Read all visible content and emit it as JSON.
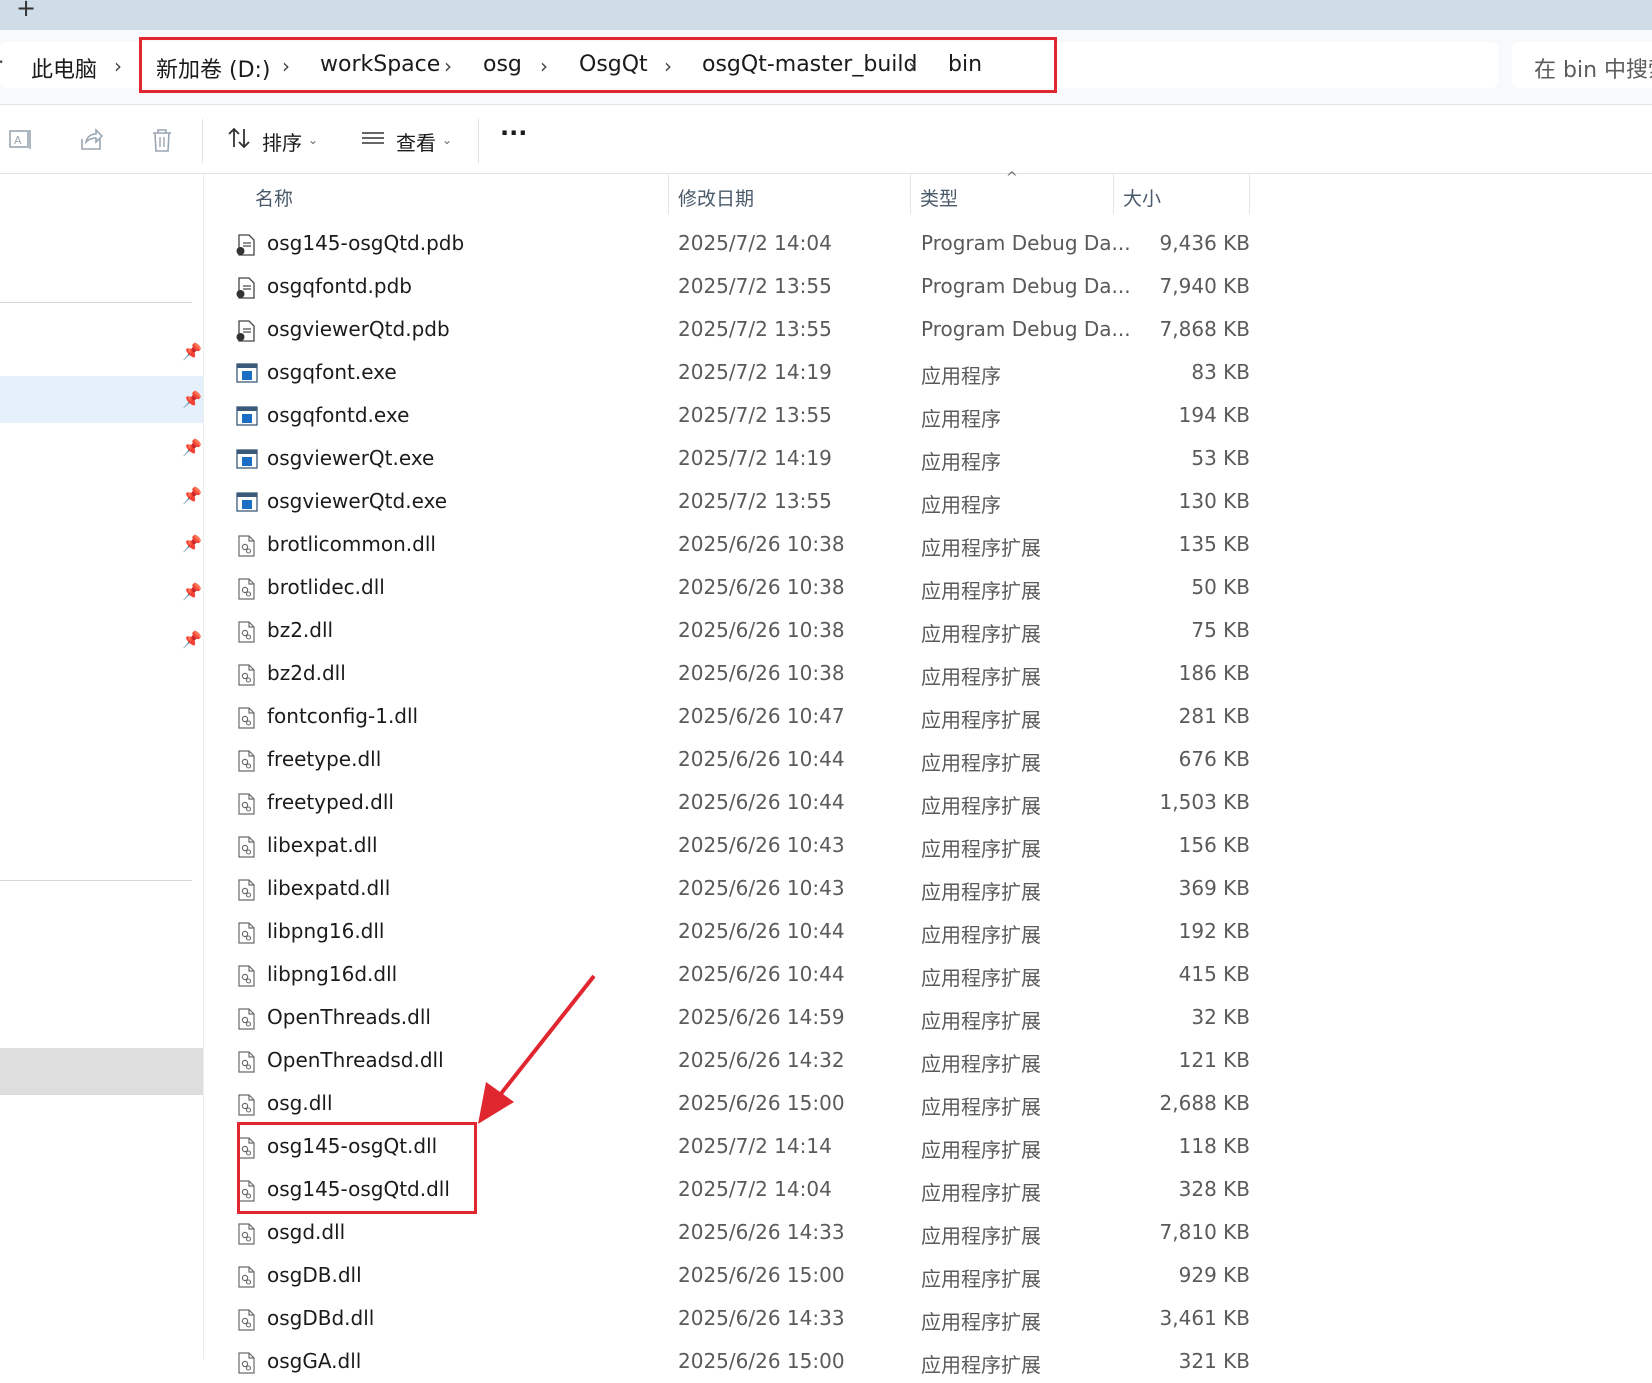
{
  "titlebar": {
    "new_tab": "+"
  },
  "address": {
    "lead": "·",
    "crumbs": [
      "此电脑",
      "新加卷 (D:)",
      "workSpace",
      "osg",
      "OsgQt",
      "osgQt-master_build",
      "bin"
    ],
    "separator": "›"
  },
  "search": {
    "placeholder": "在 bin 中搜索"
  },
  "toolbar": {
    "sort_label": "排序",
    "view_label": "查看",
    "more_label": "···"
  },
  "columns": {
    "name": "名称",
    "date": "修改日期",
    "type": "类型",
    "size": "大小"
  },
  "files": [
    {
      "name": "osg145-osgQtd.pdb",
      "date": "2025/7/2 14:04",
      "type": "Program Debug Da...",
      "size": "9,436 KB",
      "kind": "pdb"
    },
    {
      "name": "osgqfontd.pdb",
      "date": "2025/7/2 13:55",
      "type": "Program Debug Da...",
      "size": "7,940 KB",
      "kind": "pdb"
    },
    {
      "name": "osgviewerQtd.pdb",
      "date": "2025/7/2 13:55",
      "type": "Program Debug Da...",
      "size": "7,868 KB",
      "kind": "pdb"
    },
    {
      "name": "osgqfont.exe",
      "date": "2025/7/2 14:19",
      "type": "应用程序",
      "size": "83 KB",
      "kind": "exe"
    },
    {
      "name": "osgqfontd.exe",
      "date": "2025/7/2 13:55",
      "type": "应用程序",
      "size": "194 KB",
      "kind": "exe"
    },
    {
      "name": "osgviewerQt.exe",
      "date": "2025/7/2 14:19",
      "type": "应用程序",
      "size": "53 KB",
      "kind": "exe"
    },
    {
      "name": "osgviewerQtd.exe",
      "date": "2025/7/2 13:55",
      "type": "应用程序",
      "size": "130 KB",
      "kind": "exe"
    },
    {
      "name": "brotlicommon.dll",
      "date": "2025/6/26 10:38",
      "type": "应用程序扩展",
      "size": "135 KB",
      "kind": "dll"
    },
    {
      "name": "brotlidec.dll",
      "date": "2025/6/26 10:38",
      "type": "应用程序扩展",
      "size": "50 KB",
      "kind": "dll"
    },
    {
      "name": "bz2.dll",
      "date": "2025/6/26 10:38",
      "type": "应用程序扩展",
      "size": "75 KB",
      "kind": "dll"
    },
    {
      "name": "bz2d.dll",
      "date": "2025/6/26 10:38",
      "type": "应用程序扩展",
      "size": "186 KB",
      "kind": "dll"
    },
    {
      "name": "fontconfig-1.dll",
      "date": "2025/6/26 10:47",
      "type": "应用程序扩展",
      "size": "281 KB",
      "kind": "dll"
    },
    {
      "name": "freetype.dll",
      "date": "2025/6/26 10:44",
      "type": "应用程序扩展",
      "size": "676 KB",
      "kind": "dll"
    },
    {
      "name": "freetyped.dll",
      "date": "2025/6/26 10:44",
      "type": "应用程序扩展",
      "size": "1,503 KB",
      "kind": "dll"
    },
    {
      "name": "libexpat.dll",
      "date": "2025/6/26 10:43",
      "type": "应用程序扩展",
      "size": "156 KB",
      "kind": "dll"
    },
    {
      "name": "libexpatd.dll",
      "date": "2025/6/26 10:43",
      "type": "应用程序扩展",
      "size": "369 KB",
      "kind": "dll"
    },
    {
      "name": "libpng16.dll",
      "date": "2025/6/26 10:44",
      "type": "应用程序扩展",
      "size": "192 KB",
      "kind": "dll"
    },
    {
      "name": "libpng16d.dll",
      "date": "2025/6/26 10:44",
      "type": "应用程序扩展",
      "size": "415 KB",
      "kind": "dll"
    },
    {
      "name": "OpenThreads.dll",
      "date": "2025/6/26 14:59",
      "type": "应用程序扩展",
      "size": "32 KB",
      "kind": "dll"
    },
    {
      "name": "OpenThreadsd.dll",
      "date": "2025/6/26 14:32",
      "type": "应用程序扩展",
      "size": "121 KB",
      "kind": "dll"
    },
    {
      "name": "osg.dll",
      "date": "2025/6/26 15:00",
      "type": "应用程序扩展",
      "size": "2,688 KB",
      "kind": "dll"
    },
    {
      "name": "osg145-osgQt.dll",
      "date": "2025/7/2 14:14",
      "type": "应用程序扩展",
      "size": "118 KB",
      "kind": "dll"
    },
    {
      "name": "osg145-osgQtd.dll",
      "date": "2025/7/2 14:04",
      "type": "应用程序扩展",
      "size": "328 KB",
      "kind": "dll"
    },
    {
      "name": "osgd.dll",
      "date": "2025/6/26 14:33",
      "type": "应用程序扩展",
      "size": "7,810 KB",
      "kind": "dll"
    },
    {
      "name": "osgDB.dll",
      "date": "2025/6/26 15:00",
      "type": "应用程序扩展",
      "size": "929 KB",
      "kind": "dll"
    },
    {
      "name": "osgDBd.dll",
      "date": "2025/6/26 14:33",
      "type": "应用程序扩展",
      "size": "3,461 KB",
      "kind": "dll"
    },
    {
      "name": "osgGA.dll",
      "date": "2025/6/26 15:00",
      "type": "应用程序扩展",
      "size": "321 KB",
      "kind": "dll"
    }
  ],
  "colors": {
    "highlight": "#e0262e",
    "exe_blue": "#1a6fc4",
    "nav_selected": "#e6f0fb"
  },
  "icons": {
    "pin": "pin-icon",
    "sort": "sort-icon",
    "view": "view-list-icon",
    "more": "more-icon"
  }
}
